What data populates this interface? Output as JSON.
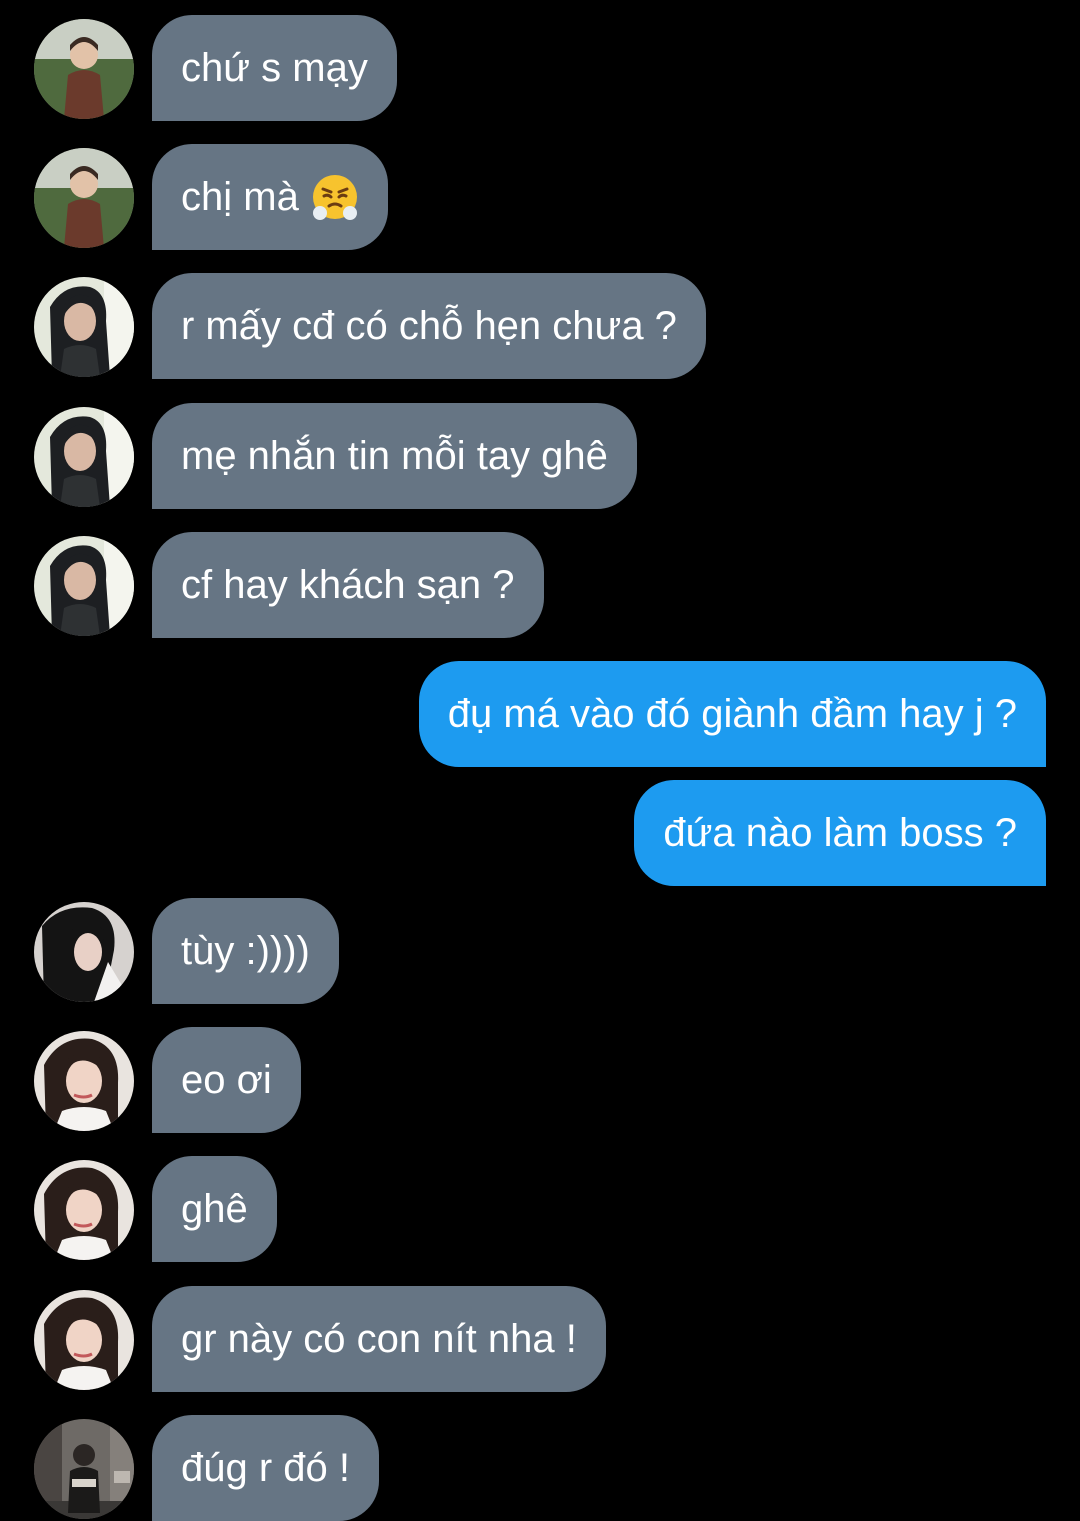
{
  "messages": [
    {
      "from": "other",
      "avatar": "child-avatar-icon",
      "text": "chứ s mạy"
    },
    {
      "from": "other",
      "avatar": "child-avatar-icon",
      "text": "chị mà",
      "emoji": "steam-from-nose-emoji-icon"
    },
    {
      "from": "other",
      "avatar": "dark-hair-girl-avatar-icon",
      "text": "r mấy cđ có chỗ hẹn chưa ?"
    },
    {
      "from": "other",
      "avatar": "dark-hair-girl-avatar-icon",
      "text": "mẹ nhắn tin mỗi tay ghê"
    },
    {
      "from": "other",
      "avatar": "dark-hair-girl-avatar-icon",
      "text": "cf hay khách sạn ?"
    },
    {
      "from": "me",
      "text": "đụ má vào đó giành đầm hay j ?"
    },
    {
      "from": "me",
      "text": "đứa nào làm boss ?"
    },
    {
      "from": "other",
      "avatar": "long-hair-girl-avatar-icon",
      "text": "tùy :))))"
    },
    {
      "from": "other",
      "avatar": "selfie-girl-avatar-icon",
      "text": "eo ơi"
    },
    {
      "from": "other",
      "avatar": "selfie-girl-avatar-icon",
      "text": "ghê"
    },
    {
      "from": "other",
      "avatar": "selfie-girl-avatar-icon",
      "text": "gr này có con nít nha !"
    },
    {
      "from": "other",
      "avatar": "street-boy-avatar-icon",
      "text": "đúg r đó !"
    }
  ],
  "colors": {
    "background": "#000000",
    "incoming_bubble": "#667584",
    "outgoing_bubble": "#1d9bf0",
    "text": "#ffffff"
  }
}
